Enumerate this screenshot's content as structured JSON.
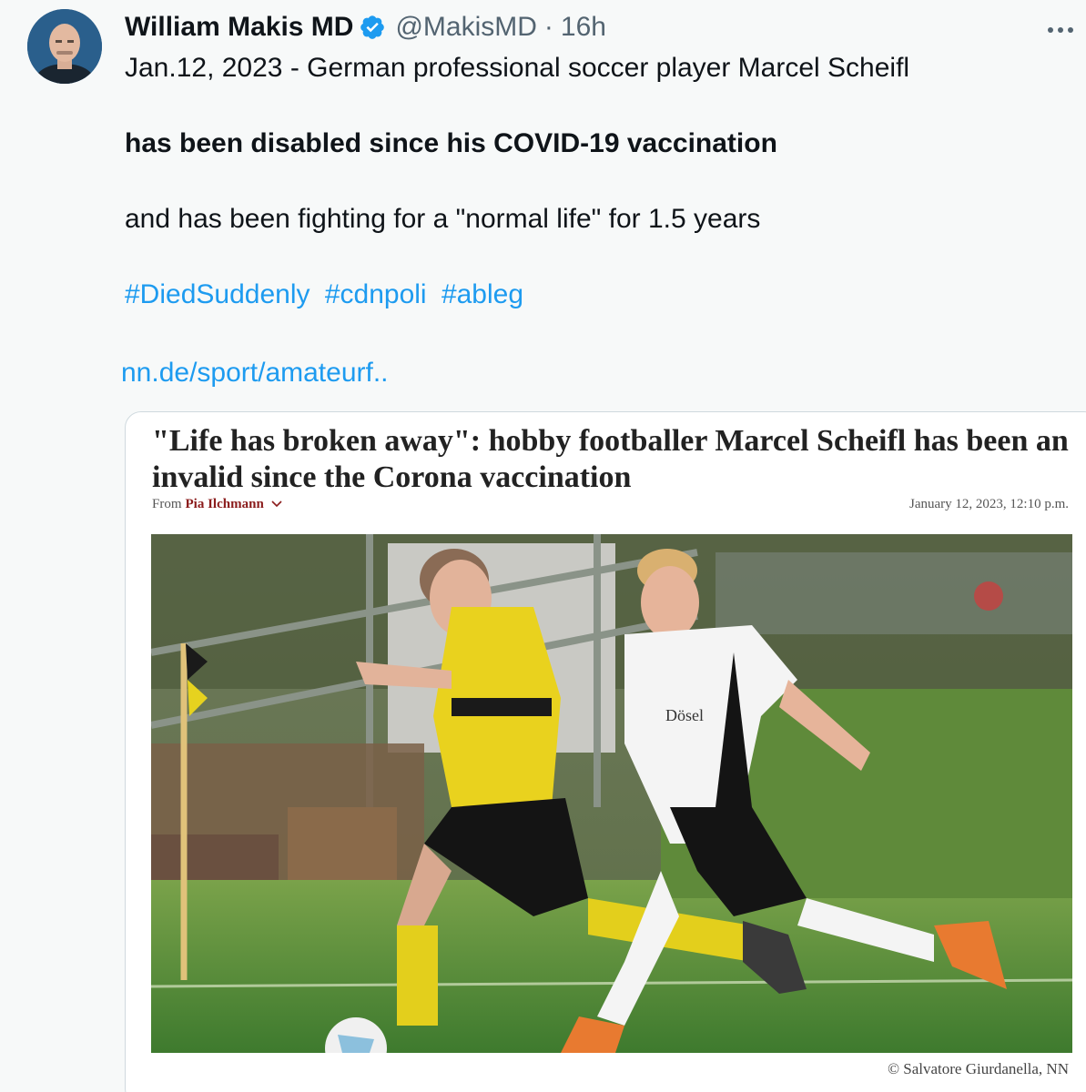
{
  "author": {
    "name": "William Makis MD",
    "handle": "@MakisMD",
    "separator": "·",
    "time": "16h",
    "verified": true
  },
  "tweet": {
    "line1": "Jan.12, 2023 - German professional soccer player Marcel Scheifl",
    "line2": "has been disabled since his COVID-19 vaccination",
    "line3": "and has been fighting for a \"normal life\" for 1.5 years",
    "hashtags": [
      "#DiedSuddenly",
      "#cdnpoli",
      "#ableg"
    ],
    "link": "nn.de/sport/amateurf.."
  },
  "card": {
    "title": "\"Life has broken away\": hobby footballer Marcel Scheifl has been an invalid since the Corona vaccination",
    "byline_prefix": "From",
    "byline_author": "Pia Ilchmann",
    "date": "January 12, 2023, 12:10 p.m.",
    "credit": "© Salvatore Giurdanella, NN",
    "jersey_text": "Dösel"
  },
  "colors": {
    "link": "#1d9bf0",
    "verified": "#1d9bf0",
    "text": "#0f1419",
    "muted": "#536471",
    "byline_author": "#8b1c1c"
  },
  "icons": {
    "verified": "verified-badge-icon",
    "more": "more-icon",
    "chevron": "chevron-down-icon"
  }
}
